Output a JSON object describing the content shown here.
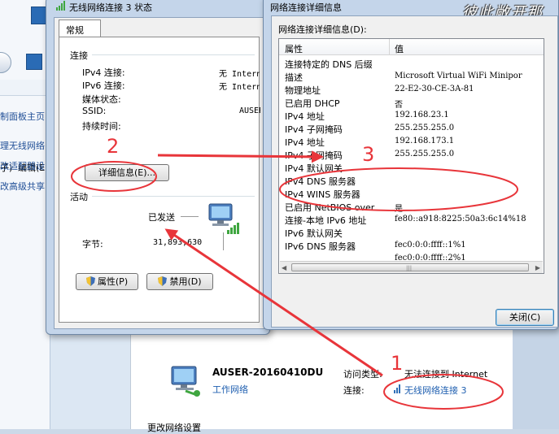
{
  "background": {
    "sidebar_items": [
      "制面板主页",
      "理无线网络",
      "改适配器设",
      "改高级共享"
    ],
    "menu": {
      "view": "子)",
      "edit": "编辑(E)"
    },
    "computer_name": "AUSER-20160410DU",
    "network_type": "工作网络",
    "access_type_label": "访问类型:",
    "access_type_value": "无法连接到 Internet",
    "connection_label": "连接:",
    "connection_link": "无线网络连接 3",
    "change_settings": "更改网络设置"
  },
  "status_dialog": {
    "title": "无线网络连接 3 状态",
    "tab": "常规",
    "connection_group": "连接",
    "rows": [
      {
        "label": "IPv4 连接:",
        "value": "无 Internet"
      },
      {
        "label": "IPv6 连接:",
        "value": "无 Internet"
      },
      {
        "label": "媒体状态:",
        "value": ""
      },
      {
        "label": "SSID:",
        "value": "AUSER"
      },
      {
        "label": "持续时间:",
        "value": ""
      }
    ],
    "details_button": "详细信息(E)...",
    "activity_group": "活动",
    "sent_label": "已发送",
    "bytes_label": "字节:",
    "bytes_sent": "31,893,630",
    "properties_button": "属性(P)",
    "disable_button": "禁用(D)"
  },
  "details_dialog": {
    "title": "网络连接详细信息",
    "watermark": "彼此敞开那",
    "caption": "网络连接详细信息(D):",
    "columns": {
      "property": "属性",
      "value": "值"
    },
    "rows": [
      {
        "property": "连接特定的 DNS 后缀",
        "value": ""
      },
      {
        "property": "描述",
        "value": "Microsoft Virtual WiFi Minipor"
      },
      {
        "property": "物理地址",
        "value": "22-E2-30-CE-3A-81"
      },
      {
        "property": "已启用 DHCP",
        "value": "否"
      },
      {
        "property": "IPv4 地址",
        "value": "192.168.23.1"
      },
      {
        "property": "IPv4 子网掩码",
        "value": "255.255.255.0"
      },
      {
        "property": "IPv4 地址",
        "value": "192.168.173.1"
      },
      {
        "property": "IPv4 子网掩码",
        "value": "255.255.255.0"
      },
      {
        "property": "IPv4 默认网关",
        "value": ""
      },
      {
        "property": "IPv4 DNS 服务器",
        "value": ""
      },
      {
        "property": "IPv4 WINS 服务器",
        "value": ""
      },
      {
        "property": "已启用 NetBIOS over",
        "value": "是"
      },
      {
        "property": "连接-本地 IPv6 地址",
        "value": "fe80::a918:8225:50a3:6c14%18"
      },
      {
        "property": "IPv6 默认网关",
        "value": ""
      },
      {
        "property": "IPv6 DNS 服务器",
        "value": "fec0:0:0:ffff::1%1"
      },
      {
        "property": "",
        "value": "fec0:0:0:ffff::2%1"
      }
    ],
    "close_button": "关闭(C)"
  },
  "annotations": {
    "step1": "1",
    "step2": "2",
    "step3": "3",
    "color": "#e8353a"
  }
}
